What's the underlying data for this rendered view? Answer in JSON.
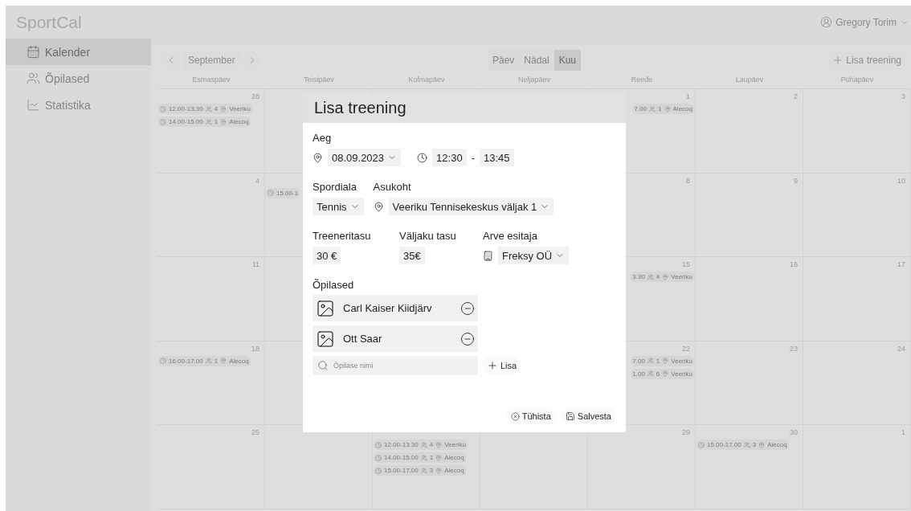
{
  "app": {
    "title": "SportCal"
  },
  "user": {
    "name": "Gregory Torim"
  },
  "sidebar": {
    "items": [
      {
        "label": "Kalender",
        "kind": "calendar",
        "selected": true
      },
      {
        "label": "Õpilased",
        "kind": "students",
        "selected": false
      },
      {
        "label": "Statistika",
        "kind": "stats",
        "selected": false
      }
    ]
  },
  "calendar": {
    "month": "September",
    "views": [
      {
        "label": "Päev",
        "selected": false
      },
      {
        "label": "Nädal",
        "selected": false
      },
      {
        "label": "Kuu",
        "selected": true
      }
    ],
    "add_button": "Lisa treening",
    "weekdays": [
      "Esmaspäev",
      "Teisipäev",
      "Kolmapäev",
      "Neljapäev",
      "Reede",
      "Laupäev",
      "Pühapäev"
    ],
    "weeks": [
      {
        "days": [
          {
            "kind": "day",
            "number": "28",
            "events": [
              {
                "kind": "full",
                "time": "12.00-13.30",
                "count": "4",
                "place": "Veeriku"
              },
              {
                "kind": "full",
                "time": "14.00-15.00",
                "count": "1",
                "place": "Alecoq"
              }
            ]
          },
          {
            "kind": "covered"
          },
          {
            "kind": "covered"
          },
          {
            "kind": "covered"
          },
          {
            "kind": "day",
            "number": "1",
            "events": [
              {
                "kind": "tail",
                "time": "7.00",
                "count": "1",
                "place": "Alecoq"
              }
            ]
          },
          {
            "kind": "day",
            "number": "2"
          },
          {
            "kind": "day",
            "number": "3"
          }
        ]
      },
      {
        "days": [
          {
            "kind": "day",
            "number": "4"
          },
          {
            "kind": "covered",
            "events": [
              {
                "kind": "head",
                "time": "15.00-1"
              }
            ]
          },
          {
            "kind": "hidden"
          },
          {
            "kind": "hidden"
          },
          {
            "kind": "day",
            "number": "8"
          },
          {
            "kind": "day",
            "number": "9"
          },
          {
            "kind": "day",
            "number": "10"
          }
        ]
      },
      {
        "days": [
          {
            "kind": "day",
            "number": "11"
          },
          {
            "kind": "covered"
          },
          {
            "kind": "hidden"
          },
          {
            "kind": "hidden"
          },
          {
            "kind": "day",
            "number": "15",
            "events": [
              {
                "kind": "tail",
                "time": "3.30",
                "count": "4",
                "place": "Veeriku"
              }
            ]
          },
          {
            "kind": "day",
            "number": "16"
          },
          {
            "kind": "day",
            "number": "17"
          }
        ]
      },
      {
        "days": [
          {
            "kind": "day",
            "number": "18",
            "events": [
              {
                "kind": "full",
                "time": "16.00-17.00",
                "count": "1",
                "place": "Alecoq"
              }
            ]
          },
          {
            "kind": "covered"
          },
          {
            "kind": "covered"
          },
          {
            "kind": "covered"
          },
          {
            "kind": "day",
            "number": "22",
            "events": [
              {
                "kind": "tail",
                "time": "7.00",
                "count": "1",
                "place": "Veeriku"
              },
              {
                "kind": "tail",
                "time": "1.00",
                "count": "6",
                "place": "Veeriku"
              }
            ]
          },
          {
            "kind": "day",
            "number": "23"
          },
          {
            "kind": "day",
            "number": "24"
          }
        ]
      },
      {
        "days": [
          {
            "kind": "day",
            "number": "25"
          },
          {
            "kind": "covered"
          },
          {
            "kind": "covered",
            "events": [
              {
                "kind": "full",
                "time": "12.00-13.30",
                "count": "4",
                "place": "Veeriku"
              },
              {
                "kind": "full",
                "time": "14.00-15.00",
                "count": "1",
                "place": "Alecoq"
              },
              {
                "kind": "full",
                "time": "15.00-17.00",
                "count": "3",
                "place": "Alecoq"
              }
            ]
          },
          {
            "kind": "covered"
          },
          {
            "kind": "day",
            "number": "29"
          },
          {
            "kind": "day",
            "number": "30",
            "events": [
              {
                "kind": "full",
                "time": "15.00-17.00",
                "count": "3",
                "place": "Alecoq"
              }
            ]
          },
          {
            "kind": "day",
            "number": "1"
          }
        ]
      }
    ]
  },
  "dialog": {
    "title": "Lisa treening",
    "time_label": "Aeg",
    "date": "08.09.2023",
    "start": "12:30",
    "separator": "-",
    "end": "13:45",
    "sport_label": "Spordiala",
    "sport": "Tennis",
    "location_label": "Asukoht",
    "location": "Veeriku Tennisekeskus väljak 1",
    "coach_fee_label": "Treeneritasu",
    "coach_fee": "30 €",
    "court_fee_label": "Väljaku tasu",
    "court_fee": "35€",
    "payer_label": "Arve esitaja",
    "payer": "Freksy OÜ",
    "students_label": "Õpilased",
    "students": [
      {
        "name": "Carl Kaiser Kiidjärv"
      },
      {
        "name": "Ott Saar"
      }
    ],
    "search_placeholder": "Õpilase nimi",
    "add_label": "Lisa",
    "cancel": "Tühista",
    "save": "Salvesta"
  }
}
